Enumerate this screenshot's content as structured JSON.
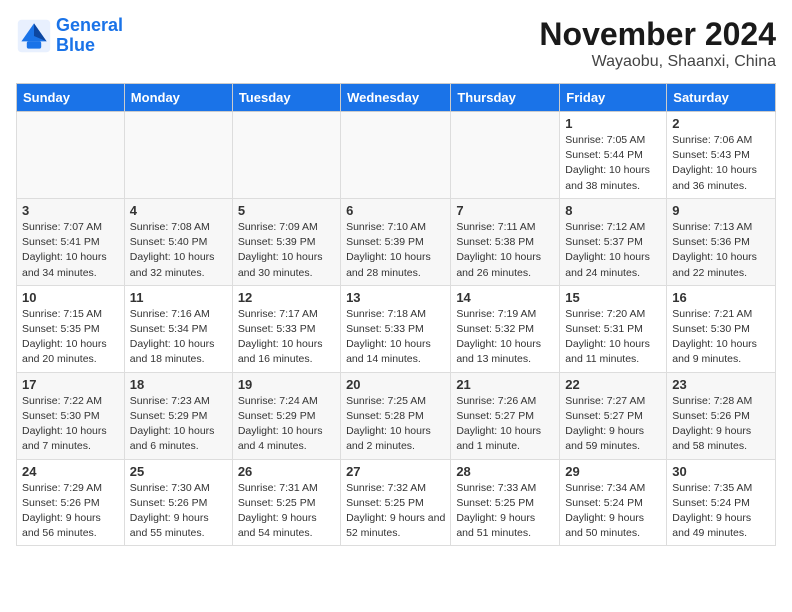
{
  "header": {
    "logo_line1": "General",
    "logo_line2": "Blue",
    "month": "November 2024",
    "location": "Wayaobu, Shaanxi, China"
  },
  "weekdays": [
    "Sunday",
    "Monday",
    "Tuesday",
    "Wednesday",
    "Thursday",
    "Friday",
    "Saturday"
  ],
  "weeks": [
    [
      {
        "day": "",
        "detail": ""
      },
      {
        "day": "",
        "detail": ""
      },
      {
        "day": "",
        "detail": ""
      },
      {
        "day": "",
        "detail": ""
      },
      {
        "day": "",
        "detail": ""
      },
      {
        "day": "1",
        "detail": "Sunrise: 7:05 AM\nSunset: 5:44 PM\nDaylight: 10 hours and 38 minutes."
      },
      {
        "day": "2",
        "detail": "Sunrise: 7:06 AM\nSunset: 5:43 PM\nDaylight: 10 hours and 36 minutes."
      }
    ],
    [
      {
        "day": "3",
        "detail": "Sunrise: 7:07 AM\nSunset: 5:41 PM\nDaylight: 10 hours and 34 minutes."
      },
      {
        "day": "4",
        "detail": "Sunrise: 7:08 AM\nSunset: 5:40 PM\nDaylight: 10 hours and 32 minutes."
      },
      {
        "day": "5",
        "detail": "Sunrise: 7:09 AM\nSunset: 5:39 PM\nDaylight: 10 hours and 30 minutes."
      },
      {
        "day": "6",
        "detail": "Sunrise: 7:10 AM\nSunset: 5:39 PM\nDaylight: 10 hours and 28 minutes."
      },
      {
        "day": "7",
        "detail": "Sunrise: 7:11 AM\nSunset: 5:38 PM\nDaylight: 10 hours and 26 minutes."
      },
      {
        "day": "8",
        "detail": "Sunrise: 7:12 AM\nSunset: 5:37 PM\nDaylight: 10 hours and 24 minutes."
      },
      {
        "day": "9",
        "detail": "Sunrise: 7:13 AM\nSunset: 5:36 PM\nDaylight: 10 hours and 22 minutes."
      }
    ],
    [
      {
        "day": "10",
        "detail": "Sunrise: 7:15 AM\nSunset: 5:35 PM\nDaylight: 10 hours and 20 minutes."
      },
      {
        "day": "11",
        "detail": "Sunrise: 7:16 AM\nSunset: 5:34 PM\nDaylight: 10 hours and 18 minutes."
      },
      {
        "day": "12",
        "detail": "Sunrise: 7:17 AM\nSunset: 5:33 PM\nDaylight: 10 hours and 16 minutes."
      },
      {
        "day": "13",
        "detail": "Sunrise: 7:18 AM\nSunset: 5:33 PM\nDaylight: 10 hours and 14 minutes."
      },
      {
        "day": "14",
        "detail": "Sunrise: 7:19 AM\nSunset: 5:32 PM\nDaylight: 10 hours and 13 minutes."
      },
      {
        "day": "15",
        "detail": "Sunrise: 7:20 AM\nSunset: 5:31 PM\nDaylight: 10 hours and 11 minutes."
      },
      {
        "day": "16",
        "detail": "Sunrise: 7:21 AM\nSunset: 5:30 PM\nDaylight: 10 hours and 9 minutes."
      }
    ],
    [
      {
        "day": "17",
        "detail": "Sunrise: 7:22 AM\nSunset: 5:30 PM\nDaylight: 10 hours and 7 minutes."
      },
      {
        "day": "18",
        "detail": "Sunrise: 7:23 AM\nSunset: 5:29 PM\nDaylight: 10 hours and 6 minutes."
      },
      {
        "day": "19",
        "detail": "Sunrise: 7:24 AM\nSunset: 5:29 PM\nDaylight: 10 hours and 4 minutes."
      },
      {
        "day": "20",
        "detail": "Sunrise: 7:25 AM\nSunset: 5:28 PM\nDaylight: 10 hours and 2 minutes."
      },
      {
        "day": "21",
        "detail": "Sunrise: 7:26 AM\nSunset: 5:27 PM\nDaylight: 10 hours and 1 minute."
      },
      {
        "day": "22",
        "detail": "Sunrise: 7:27 AM\nSunset: 5:27 PM\nDaylight: 9 hours and 59 minutes."
      },
      {
        "day": "23",
        "detail": "Sunrise: 7:28 AM\nSunset: 5:26 PM\nDaylight: 9 hours and 58 minutes."
      }
    ],
    [
      {
        "day": "24",
        "detail": "Sunrise: 7:29 AM\nSunset: 5:26 PM\nDaylight: 9 hours and 56 minutes."
      },
      {
        "day": "25",
        "detail": "Sunrise: 7:30 AM\nSunset: 5:26 PM\nDaylight: 9 hours and 55 minutes."
      },
      {
        "day": "26",
        "detail": "Sunrise: 7:31 AM\nSunset: 5:25 PM\nDaylight: 9 hours and 54 minutes."
      },
      {
        "day": "27",
        "detail": "Sunrise: 7:32 AM\nSunset: 5:25 PM\nDaylight: 9 hours and 52 minutes."
      },
      {
        "day": "28",
        "detail": "Sunrise: 7:33 AM\nSunset: 5:25 PM\nDaylight: 9 hours and 51 minutes."
      },
      {
        "day": "29",
        "detail": "Sunrise: 7:34 AM\nSunset: 5:24 PM\nDaylight: 9 hours and 50 minutes."
      },
      {
        "day": "30",
        "detail": "Sunrise: 7:35 AM\nSunset: 5:24 PM\nDaylight: 9 hours and 49 minutes."
      }
    ]
  ]
}
